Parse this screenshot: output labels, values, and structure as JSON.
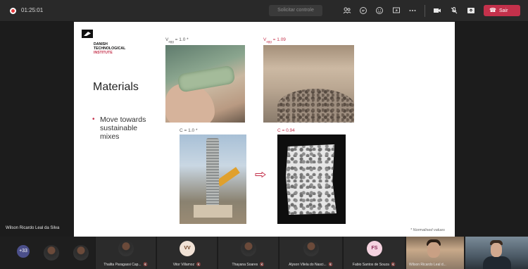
{
  "topbar": {
    "timer": "01:25:01",
    "control_button": "Solicitar controle",
    "leave_button": "Sair",
    "icons": [
      "people-icon",
      "chat-icon",
      "reactions-icon",
      "share-icon",
      "more-icon",
      "camera-icon",
      "mic-off-icon",
      "share-screen-icon"
    ]
  },
  "slide": {
    "logo_line1": "DANISH",
    "logo_line2": "TECHNOLOGICAL",
    "logo_line3": "INSTITUTE",
    "title": "Materials",
    "bullet": "Move towards sustainable mixes",
    "caption1_prefix": "V",
    "caption1_sub": "agg",
    "caption1_suffix": " = 1.0 *",
    "caption2_prefix": "V",
    "caption2_sub": "agg",
    "caption2_suffix": " = 1.09",
    "caption3": "C = 1.0 *",
    "caption4": "C = 0.94",
    "note": "* Normalised values",
    "accent_color": "#c4314b"
  },
  "speaker": "Wilson Ricardo Leal da Silva",
  "participants": {
    "overflow": "+33",
    "tiles": [
      {
        "name": "Thalita Paragassi Cap...",
        "type": "photo"
      },
      {
        "name": "Vitor Villamoz",
        "type": "initials",
        "initials": "VV"
      },
      {
        "name": "Thayana Soares",
        "type": "photo"
      },
      {
        "name": "Alyson Vilela do Nasci...",
        "type": "photo"
      },
      {
        "name": "Fabio Santos de Souza",
        "type": "initials",
        "initials": "FS"
      }
    ],
    "video1_name": "Wilson Ricardo Leal d..."
  }
}
